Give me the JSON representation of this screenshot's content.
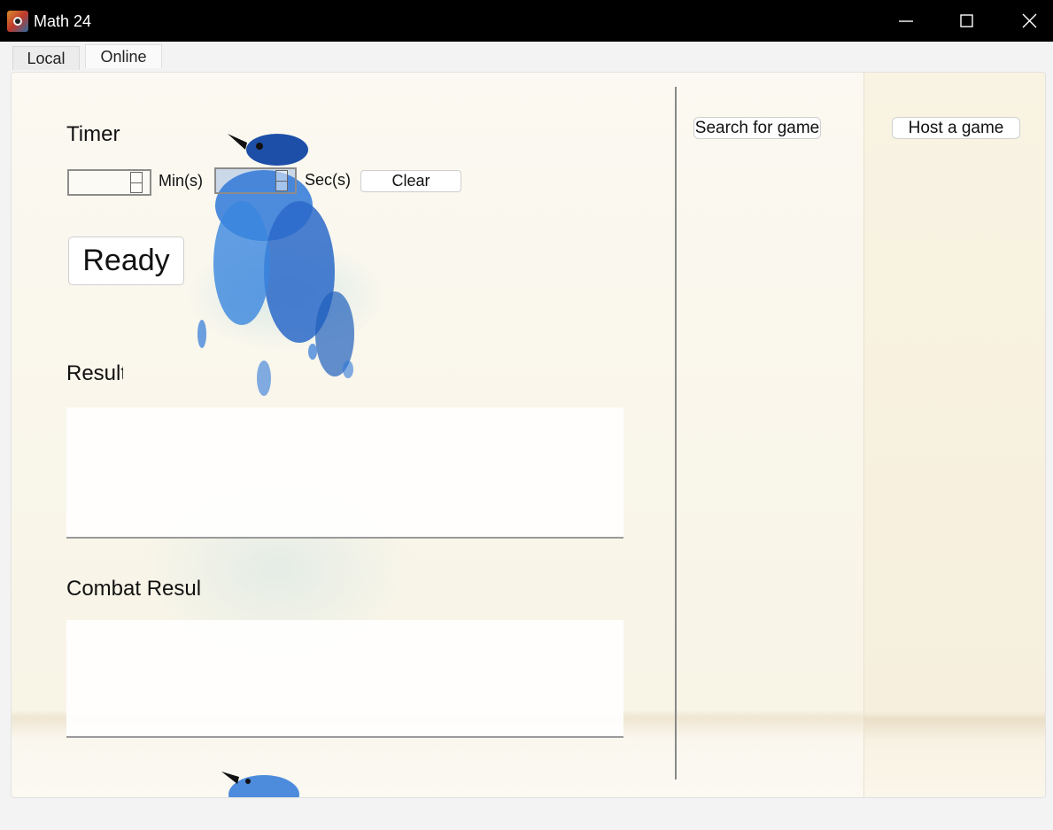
{
  "window": {
    "title": "Math 24",
    "app_icon": "app-icon",
    "controls": [
      "minimize-icon",
      "maximize-icon",
      "close-icon"
    ]
  },
  "tabs": [
    {
      "label": "Local",
      "selected": false
    },
    {
      "label": "Online",
      "selected": true
    }
  ],
  "local": {
    "timer_label": "Timer",
    "minutes_value": "",
    "minutes_unit": "Min(s)",
    "seconds_value": "",
    "seconds_unit": "Sec(s)",
    "clear_label": "Clear",
    "ready_label": "Ready",
    "result_label": "Result",
    "result_text": "",
    "combat_result_label": "Combat Result",
    "combat_result_text": ""
  },
  "online": {
    "search_label": "Search for game",
    "host_label": "Host a game"
  },
  "colors": {
    "titlebar": "#000000",
    "background": "#f3f3f3",
    "bird_blue": "#2a6fcf"
  }
}
